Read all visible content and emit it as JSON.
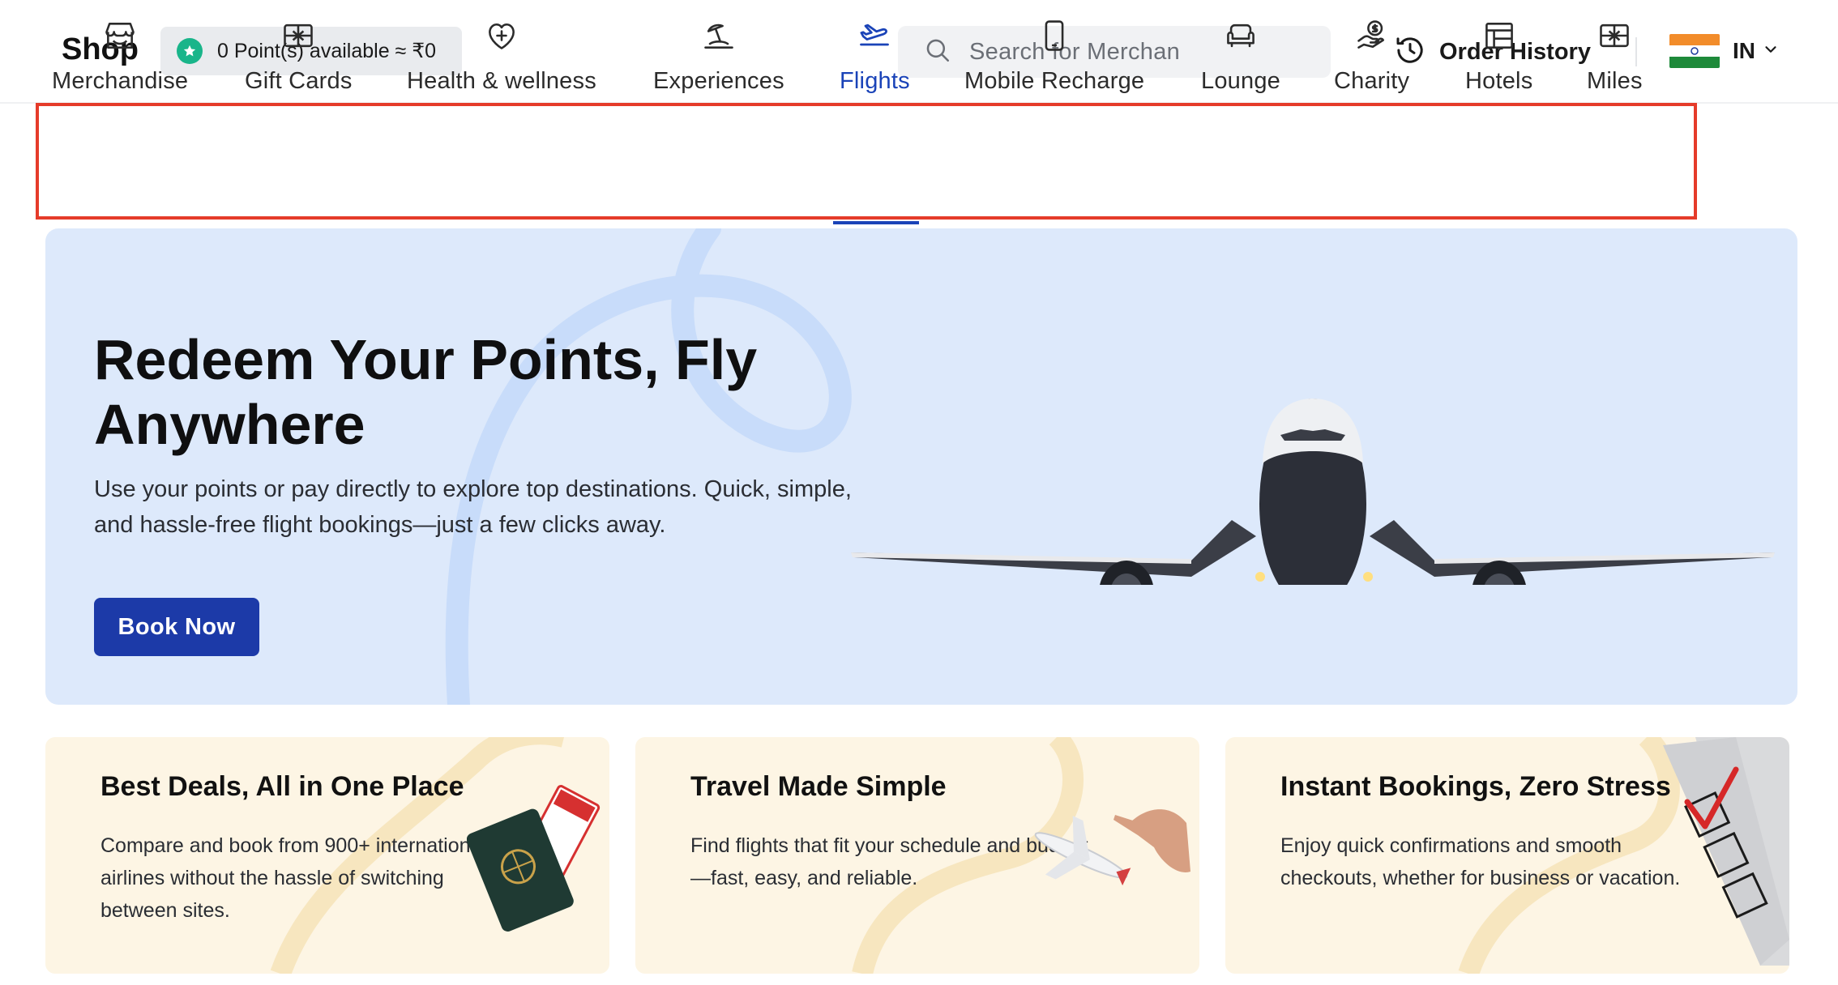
{
  "header": {
    "shop_label": "Shop",
    "points_text": "0 Point(s) available ≈ ₹0",
    "search_placeholder": "Search for Merchan",
    "order_history_label": "Order History",
    "country_code": "IN"
  },
  "categories": [
    {
      "label": "Merchandise",
      "icon": "store-icon"
    },
    {
      "label": "Gift Cards",
      "icon": "gift-card-icon"
    },
    {
      "label": "Health & wellness",
      "icon": "heart-plus-icon"
    },
    {
      "label": "Experiences",
      "icon": "beach-icon"
    },
    {
      "label": "Flights",
      "icon": "plane-takeoff-icon",
      "active": true
    },
    {
      "label": "Mobile Recharge",
      "icon": "mobile-icon"
    },
    {
      "label": "Lounge",
      "icon": "sofa-icon"
    },
    {
      "label": "Charity",
      "icon": "donation-hand-icon"
    },
    {
      "label": "Hotels",
      "icon": "hotel-icon"
    },
    {
      "label": "Miles",
      "icon": "miles-icon"
    }
  ],
  "hero": {
    "title": "Redeem Your Points, Fly Anywhere",
    "subtitle": "Use your points or pay directly to explore top destinations. Quick, simple, and hassle-free flight bookings—just a few clicks away.",
    "button_label": "Book Now"
  },
  "cards": [
    {
      "title": "Best Deals, All in One Place",
      "body": "Compare and book from 900+ international airlines without the hassle of switching between sites."
    },
    {
      "title": "Travel Made Simple",
      "body": "Find flights that fit your schedule and budget—fast, easy, and reliable."
    },
    {
      "title": "Instant Bookings, Zero Stress",
      "body": "Enjoy quick confirmations and smooth checkouts, whether for business or vacation."
    }
  ],
  "colors": {
    "accent": "#1c3aa8",
    "active_tab": "#1a43b8",
    "highlight_border": "#e53b2a",
    "hero_bg": "#dde9fb",
    "card_bg": "#fdf5e4",
    "points_star": "#19b58a"
  }
}
